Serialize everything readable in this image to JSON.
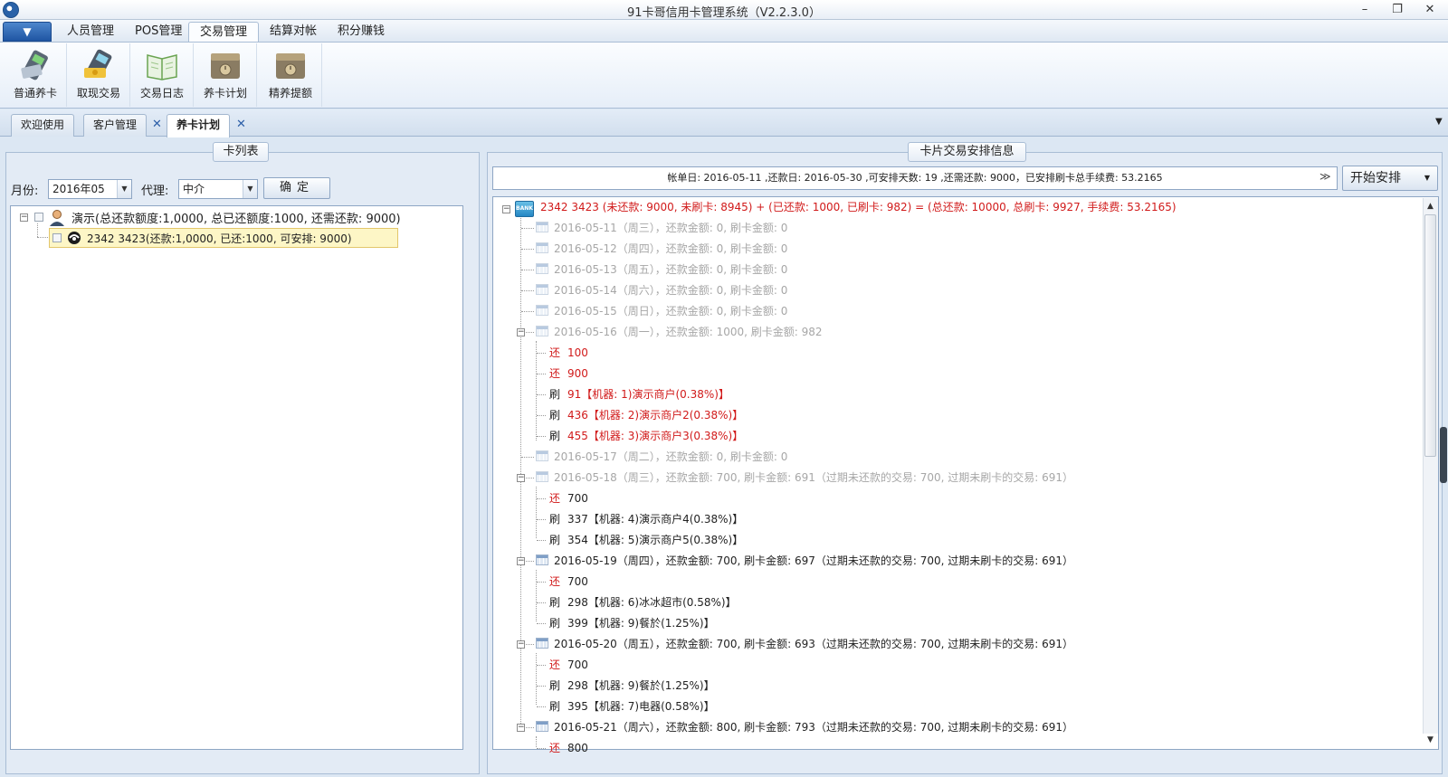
{
  "window": {
    "title": "91卡哥信用卡管理系统（V2.2.3.0）",
    "minimize_glyph": "–",
    "restore_glyph": "❐",
    "close_glyph": "✕"
  },
  "menu": {
    "app_button_glyph": "▼",
    "tabs": [
      "人员管理",
      "POS管理",
      "交易管理",
      "结算对帐",
      "积分赚钱"
    ]
  },
  "ribbon": {
    "buttons": [
      {
        "label": "普通养卡",
        "icon": "pos-terminal-icon"
      },
      {
        "label": "取现交易",
        "icon": "pos-cash-icon"
      },
      {
        "label": "交易日志",
        "icon": "open-book-icon"
      },
      {
        "label": "养卡计划",
        "icon": "safe-box-icon"
      },
      {
        "label": "精养提额",
        "icon": "safe-box-icon"
      }
    ]
  },
  "doc_tabs": [
    "欢迎使用",
    "客户管理",
    "养卡计划"
  ],
  "tab_close_glyph": "✕",
  "left_panel": {
    "caption": "卡列表",
    "month_label": "月份:",
    "month_value": "2016年05",
    "agent_label": "代理:",
    "agent_value": "中介",
    "confirm_label": "确定",
    "tree": {
      "root": "演示(总还款额度:1,0000, 总已还额度:1000, 还需还款: 9000)",
      "child": "2342 3423(还款:1,0000, 已还:1000, 可安排: 9000)"
    }
  },
  "right_panel": {
    "caption": "卡片交易安排信息",
    "summary": "帐单日: 2016-05-11 ,还款日: 2016-05-30 ,可安排天数: 19 ,还需还款: 9000，已安排刷卡总手续费: 53.2165",
    "summary_toggle": "≫",
    "start_button": "开始安排",
    "root": "2342 3423 (未还款: 9000, 未刷卡: 8945) + (已还款: 1000, 已刷卡: 982) = (总还款: 10000, 总刷卡: 9927, 手续费: 53.2165)",
    "bank_badge": "BANK",
    "rows": [
      {
        "kind": "day",
        "style": "gray",
        "text": "2016-05-11（周三），还款金额: 0, 刷卡金额: 0"
      },
      {
        "kind": "day",
        "style": "gray",
        "text": "2016-05-12（周四），还款金额: 0, 刷卡金额: 0"
      },
      {
        "kind": "day",
        "style": "gray",
        "text": "2016-05-13（周五），还款金额: 0, 刷卡金额: 0"
      },
      {
        "kind": "day",
        "style": "gray",
        "text": "2016-05-14（周六），还款金额: 0, 刷卡金额: 0"
      },
      {
        "kind": "day",
        "style": "gray",
        "text": "2016-05-15（周日），还款金额: 0, 刷卡金额: 0"
      },
      {
        "kind": "day",
        "style": "gray",
        "expanded": true,
        "text": "2016-05-16（周一），还款金额: 1000, 刷卡金额: 982"
      },
      {
        "kind": "act",
        "style": "red",
        "act": "还",
        "text": "100"
      },
      {
        "kind": "act",
        "style": "red",
        "act": "还",
        "text": "900"
      },
      {
        "kind": "act",
        "style": "red-swipe",
        "act": "刷",
        "text": "91【机器: 1)演示商户(0.38%)】"
      },
      {
        "kind": "act",
        "style": "red-swipe",
        "act": "刷",
        "text": "436【机器: 2)演示商户2(0.38%)】"
      },
      {
        "kind": "act",
        "style": "red-swipe",
        "act": "刷",
        "text": "455【机器: 3)演示商户3(0.38%)】"
      },
      {
        "kind": "day",
        "style": "gray",
        "text": "2016-05-17（周二），还款金额: 0, 刷卡金额: 0"
      },
      {
        "kind": "day",
        "style": "gray",
        "expanded": true,
        "text": "2016-05-18（周三），还款金额: 700, 刷卡金额: 691（过期未还款的交易: 700, 过期未刷卡的交易: 691）"
      },
      {
        "kind": "act",
        "style": "dark-red",
        "act": "还",
        "text": "700"
      },
      {
        "kind": "act",
        "style": "dark",
        "act": "刷",
        "text": "337【机器: 4)演示商户4(0.38%)】"
      },
      {
        "kind": "act",
        "style": "dark",
        "act": "刷",
        "text": "354【机器: 5)演示商户5(0.38%)】"
      },
      {
        "kind": "day",
        "style": "dark",
        "expanded": true,
        "text": "2016-05-19（周四），还款金额: 700, 刷卡金额: 697（过期未还款的交易: 700, 过期未刷卡的交易: 691）"
      },
      {
        "kind": "act",
        "style": "dark-red",
        "act": "还",
        "text": "700"
      },
      {
        "kind": "act",
        "style": "dark",
        "act": "刷",
        "text": "298【机器: 6)冰冰超市(0.58%)】"
      },
      {
        "kind": "act",
        "style": "dark",
        "act": "刷",
        "text": "399【机器: 9)餐於(1.25%)】"
      },
      {
        "kind": "day",
        "style": "dark",
        "expanded": true,
        "text": "2016-05-20（周五），还款金额: 700, 刷卡金额: 693（过期未还款的交易: 700, 过期未刷卡的交易: 691）"
      },
      {
        "kind": "act",
        "style": "dark-red",
        "act": "还",
        "text": "700"
      },
      {
        "kind": "act",
        "style": "dark",
        "act": "刷",
        "text": "298【机器: 9)餐於(1.25%)】"
      },
      {
        "kind": "act",
        "style": "dark",
        "act": "刷",
        "text": "395【机器: 7)电器(0.58%)】"
      },
      {
        "kind": "day",
        "style": "dark",
        "expanded": true,
        "text": "2016-05-21（周六），还款金额: 800, 刷卡金额: 793（过期未还款的交易: 700, 过期未刷卡的交易: 691）"
      },
      {
        "kind": "act",
        "style": "dark-red",
        "act": "还",
        "text": "800"
      }
    ]
  },
  "colors": {
    "accent": "#1f55a3",
    "red": "#d11a1a",
    "gray_text": "#a7a7a7"
  }
}
